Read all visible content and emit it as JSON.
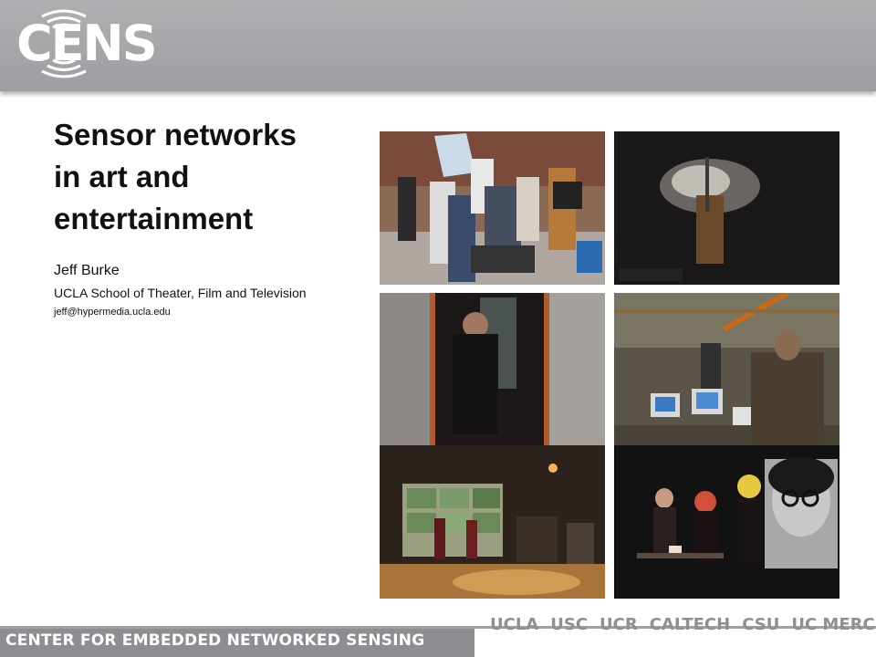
{
  "header": {
    "logo_text": "CENS"
  },
  "slide": {
    "title_lines": [
      "Sensor networks",
      "in art and",
      "entertainment"
    ],
    "author": "Jeff Burke",
    "affiliation": "UCLA School of Theater, Film and Television",
    "email": "jeff@hypermedia.ucla.edu"
  },
  "photos": [
    {
      "name": "film-crew-photo",
      "tone": "#8a6a55"
    },
    {
      "name": "smoke-performance-photo",
      "tone": "#1a1818"
    },
    {
      "name": "booth-performer-photo",
      "tone": "#3a3232"
    },
    {
      "name": "lab-workshop-photo",
      "tone": "#5a5548"
    },
    {
      "name": "projection-room-photo",
      "tone": "#2c241c"
    },
    {
      "name": "stage-actors-photo",
      "tone": "#121212"
    }
  ],
  "footer": {
    "center_name": "CENTER FOR EMBEDDED NETWORKED SENSING",
    "partners": [
      "UCLA",
      "USC",
      "UCR",
      "CALTECH",
      "CSU",
      "UC MERCED"
    ]
  }
}
